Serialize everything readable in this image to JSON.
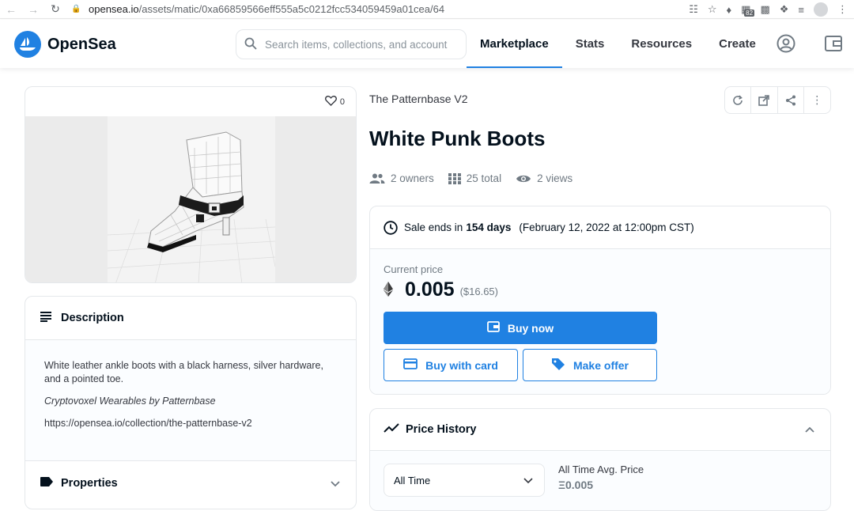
{
  "browser": {
    "url_host": "opensea.io",
    "url_path": "/assets/matic/0xa66859566eff555a5c0212fcc534059459a01cea/64",
    "extension_badge": "82"
  },
  "header": {
    "brand": "OpenSea",
    "search_placeholder": "Search items, collections, and account",
    "nav": [
      "Marketplace",
      "Stats",
      "Resources",
      "Create"
    ],
    "active_nav": "Marketplace",
    "accent_color": "#2081e2"
  },
  "asset": {
    "favorites_count": "0",
    "collection": "The Patternbase V2",
    "title": "White Punk Boots",
    "owners": "2 owners",
    "total": "25 total",
    "views": "2 views"
  },
  "description": {
    "heading": "Description",
    "text": "White leather ankle boots with a black harness, silver hardware, and a pointed toe.",
    "credit": "Cryptovoxel Wearables by Patternbase",
    "link": "https://opensea.io/collection/the-patternbase-v2"
  },
  "properties": {
    "heading": "Properties"
  },
  "sale": {
    "prefix": "Sale ends in",
    "duration": "154 days",
    "end_date": "(February 12, 2022 at 12:00pm CST)",
    "current_price_label": "Current price",
    "price": "0.005",
    "price_usd": "($16.65)",
    "buy_now": "Buy now",
    "buy_with_card": "Buy with card",
    "make_offer": "Make offer"
  },
  "price_history": {
    "heading": "Price History",
    "range": "All Time",
    "avg_label": "All Time Avg. Price",
    "avg_value": "Ξ0.005"
  }
}
